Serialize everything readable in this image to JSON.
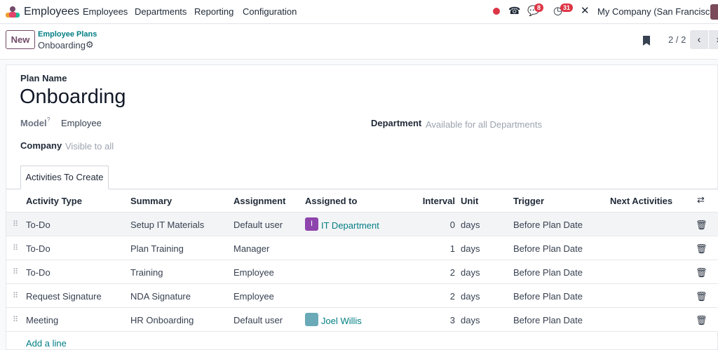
{
  "app": {
    "title": "Employees",
    "menu": [
      "Employees",
      "Departments",
      "Reporting",
      "Configuration"
    ],
    "messages_badge": "8",
    "activities_badge": "31",
    "company": "My Company (San Francisco)"
  },
  "control": {
    "new_label": "New",
    "breadcrumb_parent": "Employee Plans",
    "breadcrumb_current": "Onboarding",
    "pager": "2 / 2"
  },
  "form": {
    "plan_name_label": "Plan Name",
    "plan_name": "Onboarding",
    "model_label": "Model",
    "model_help": "?",
    "model_value": "Employee",
    "department_label": "Department",
    "department_placeholder": "Available for all Departments",
    "company_label": "Company",
    "company_placeholder": "Visible to all"
  },
  "tabs": [
    {
      "label": "Activities To Create",
      "active": true
    }
  ],
  "table": {
    "columns": [
      "Activity Type",
      "Summary",
      "Assignment",
      "Assigned to",
      "Interval",
      "Unit",
      "Trigger",
      "Next Activities"
    ],
    "rows": [
      {
        "activity_type": "To-Do",
        "summary": "Setup IT Materials",
        "assignment": "Default user",
        "assigned_to": "IT Department",
        "assigned_initial": "I",
        "interval": "0",
        "unit": "days",
        "trigger": "Before Plan Date"
      },
      {
        "activity_type": "To-Do",
        "summary": "Plan Training",
        "assignment": "Manager",
        "assigned_to": "",
        "interval": "1",
        "unit": "days",
        "trigger": "Before Plan Date"
      },
      {
        "activity_type": "To-Do",
        "summary": "Training",
        "assignment": "Employee",
        "assigned_to": "",
        "interval": "2",
        "unit": "days",
        "trigger": "Before Plan Date"
      },
      {
        "activity_type": "Request Signature",
        "summary": "NDA Signature",
        "assignment": "Employee",
        "assigned_to": "",
        "interval": "2",
        "unit": "days",
        "trigger": "Before Plan Date"
      },
      {
        "activity_type": "Meeting",
        "summary": "HR Onboarding",
        "assignment": "Default user",
        "assigned_to": "Joel Willis",
        "interval": "3",
        "unit": "days",
        "trigger": "Before Plan Date"
      }
    ],
    "add_line": "Add a line"
  },
  "colors": {
    "accent": "#017e84",
    "primary": "#714b67",
    "badge": "#dc3545"
  }
}
